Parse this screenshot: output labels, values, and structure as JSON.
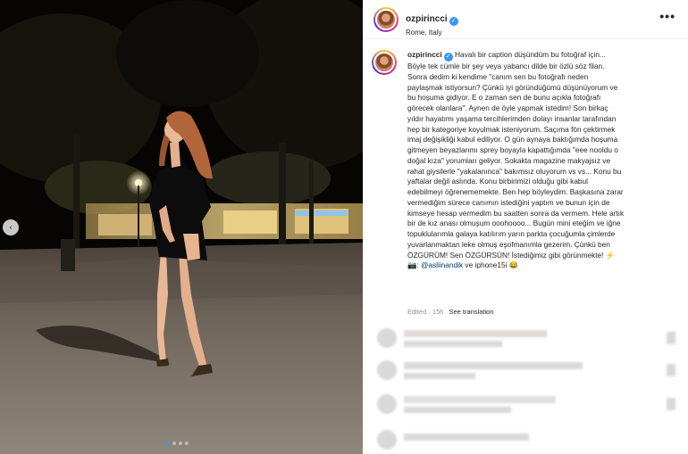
{
  "post": {
    "username": "ozpirincci",
    "location": "Rome, Italy",
    "more_label": "•••",
    "photo_alt": "Woman in black dress standing on a night street"
  },
  "caption": {
    "username": "ozpirincci",
    "lines": [
      "Havalı bir caption düşündüm bu fotoğraf için...",
      "Böyle tek cümle bir şey veya yabancı dilde bir özlü söz filan.",
      "Sonra dedim ki kendime \"canım sen bu fotoğrafı neden",
      "paylaşmak istiyorsun? Çünkü iyi göründüğümü düşünüyorum ve",
      "bu hoşuma gidiyor. E o zaman sen de bunu açıkla fotoğrafı",
      "görecek olanlara\". Aynen de öyle yapmak istedim! Son birkaç",
      "yıldır hayatımı yaşama tercihlerimden dolayı insanlar tarafından",
      "hep bir kategoriye koyulmak isteniyorum. Saçıma fön çektirmek",
      "imaj değişikliği kabul ediliyor. O gün aynaya baktığımda hoşuma",
      "gitmeyen beyazlarımı sprey boyayla kapattığımda \"eee nooldu o",
      "doğal kıza\" yorumları geliyor. Sokakta magazine makyajsız ve",
      "rahat giysilerle \"yakalanınca\" bakımsız oluyorum vs vs... Konu bu",
      "yaftalar değil aslında. Konu birbirimizi olduğu gibi kabul",
      "edebilmeyi öğrenememekte. Ben hep böyleydim. Başkasına zarar",
      "vermediğim sürece canımın istediğini yaptım ve bunun için de",
      "kimseye hesap vermedim bu saatten sonra da vermem. Hele artık",
      "bir de kız anası olmuşum ooohoooo... Bugün mini eteğim ve iğne",
      "topuklularımla galaya katılırım yarın parkta çocuğumla çimlerde",
      "yuvarlanmaktan leke olmuş eşofmanımla gezerim. Çünkü ben",
      "ÖZGÜRÜM! Sen ÖZGÜRSÜN! İstediğimiz gibi görünmekte! ⚡"
    ],
    "last_prefix": "📷: ",
    "mention": "@asliinandik",
    "last_suffix": " ve iphone15i 😂"
  },
  "meta": {
    "edited": "Edited · 15h",
    "see_translation": "See translation"
  },
  "carousel": {
    "prev_icon": "‹",
    "dot_count": 4,
    "active_dot": 0
  },
  "colors": {
    "verified": "#3897f0",
    "mention": "#00376b",
    "dot_active": "#3a97f0"
  }
}
